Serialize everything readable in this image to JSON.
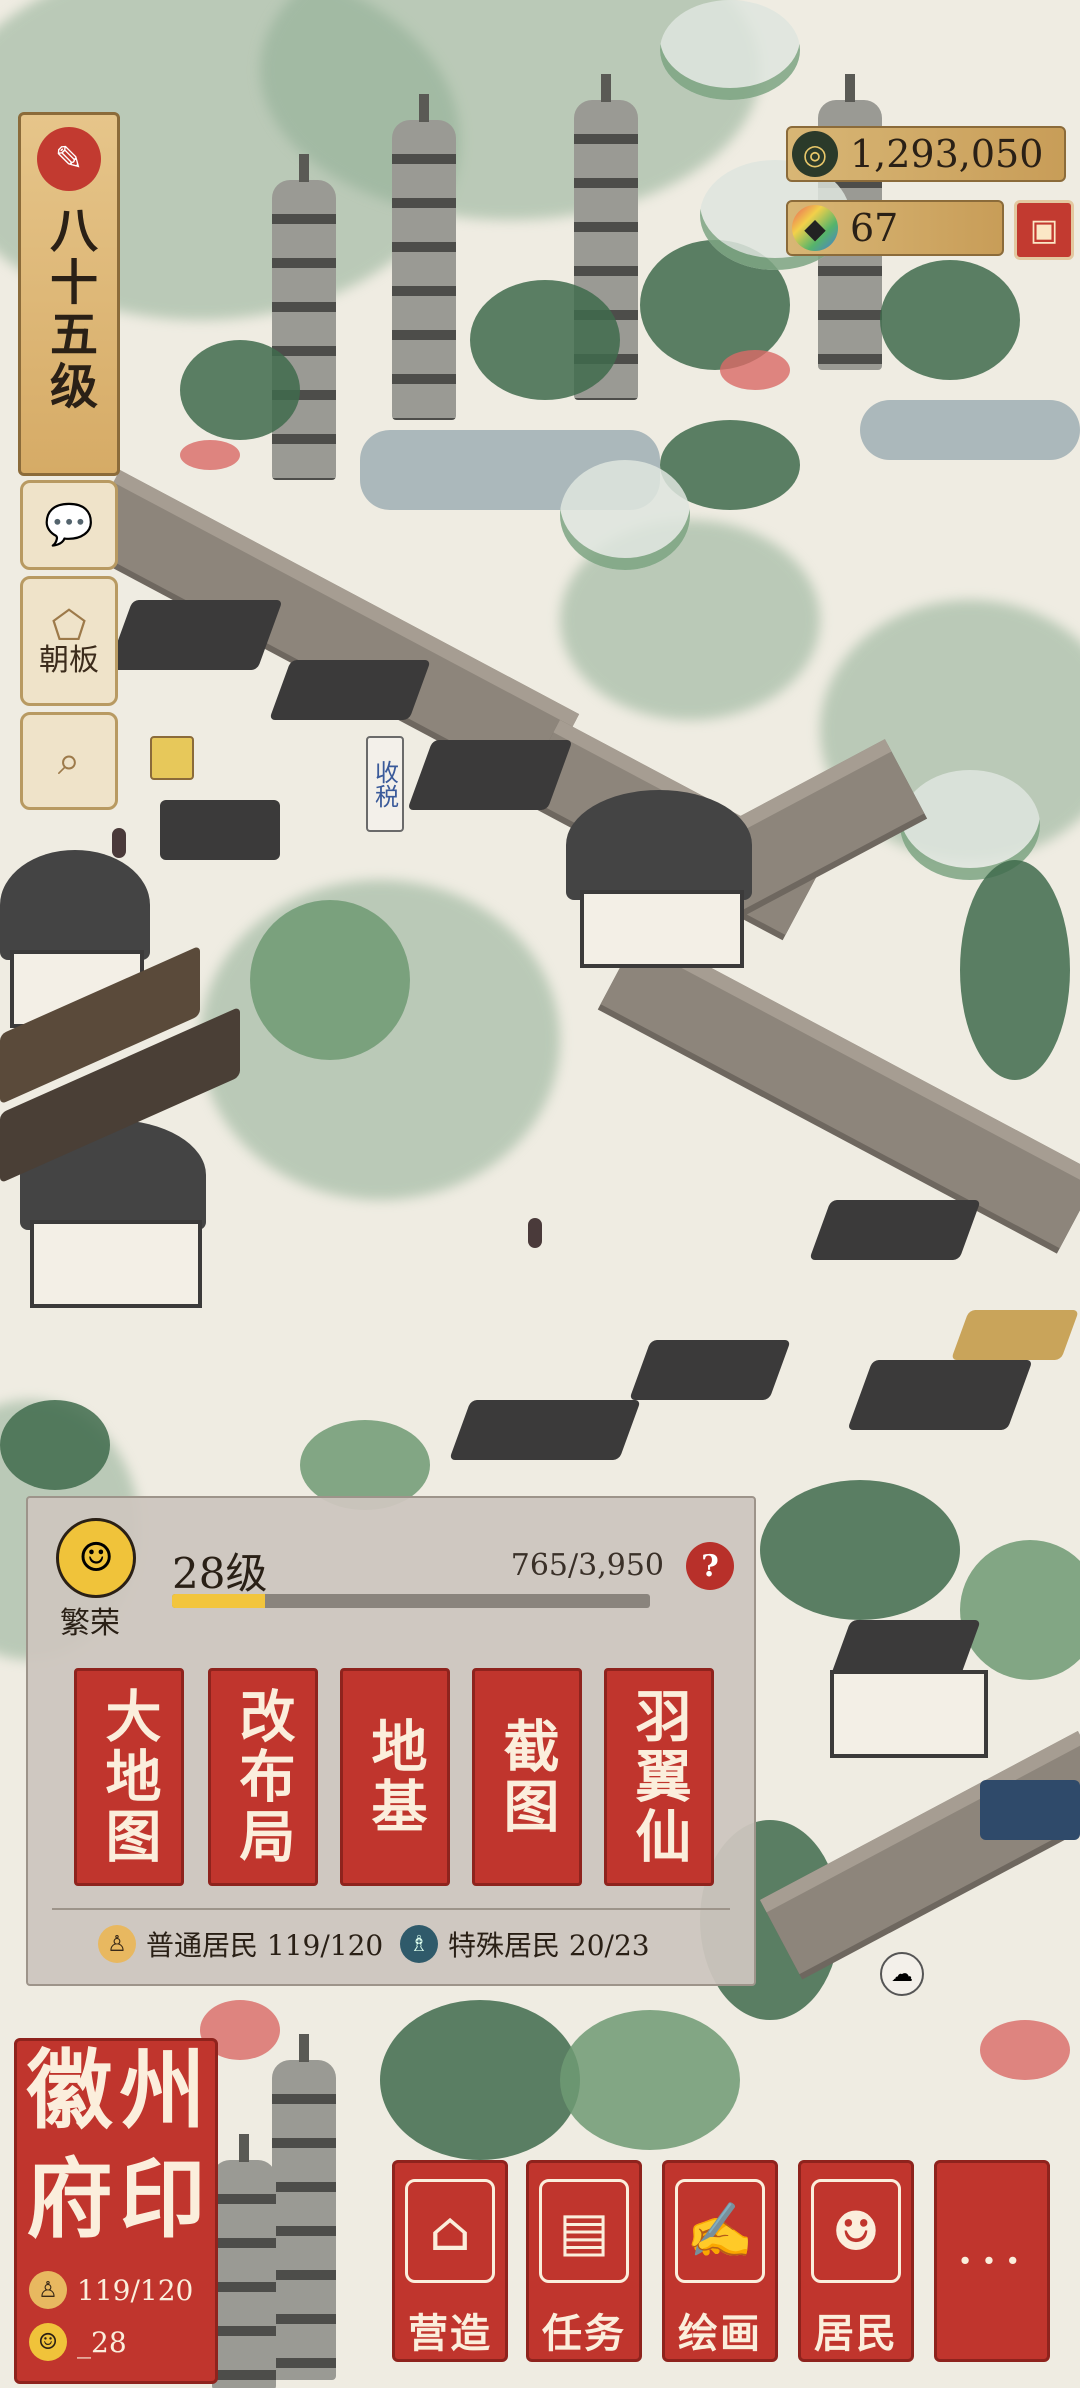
{
  "hud": {
    "level_label": "八十五级",
    "side_buttons": [
      {
        "icon": "chat-icon",
        "label": ""
      },
      {
        "icon": "board-icon",
        "label": "朝板"
      },
      {
        "icon": "search-house-icon",
        "label": ""
      }
    ]
  },
  "currency": {
    "coins": "1,293,050",
    "gems": "67"
  },
  "map": {
    "tax_label": "收税"
  },
  "prosperity": {
    "label": "繁荣",
    "level": "28级",
    "xp": "765/3,950",
    "progress_fraction": 0.194,
    "help_label": "?",
    "buttons": [
      {
        "label": "大地图"
      },
      {
        "label": "改布局"
      },
      {
        "label": "地基"
      },
      {
        "label": "截图"
      },
      {
        "label": "羽翼仙"
      }
    ],
    "residents": {
      "normal_label": "普通居民 119/120",
      "special_label": "特殊居民 20/23"
    }
  },
  "seal": {
    "title_chars": [
      "徽",
      "州",
      "府",
      "印"
    ],
    "residents": "119/120",
    "prosperity": "_28"
  },
  "actions": [
    {
      "label": "营造",
      "icon": "build-icon"
    },
    {
      "label": "任务",
      "icon": "task-book-icon"
    },
    {
      "label": "绘画",
      "icon": "painting-scroll-icon"
    },
    {
      "label": "居民",
      "icon": "resident-icon"
    },
    {
      "label": "···",
      "icon": "more-icon"
    }
  ],
  "colors": {
    "accent_red": "#c0352d",
    "gold": "#d8b675",
    "progress": "#f2c53d"
  }
}
